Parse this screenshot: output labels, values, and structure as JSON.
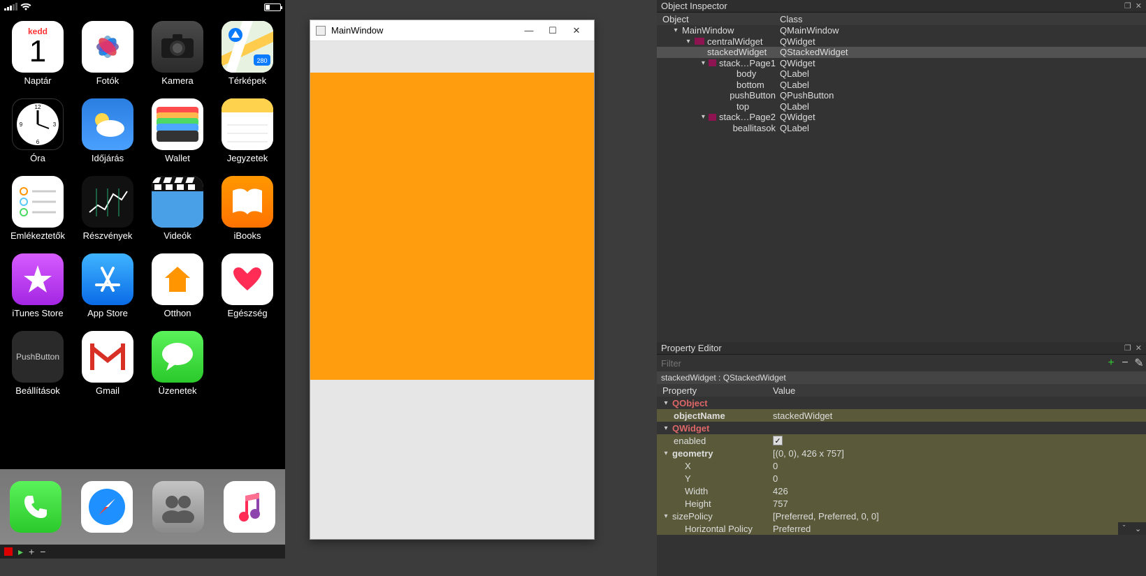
{
  "phone": {
    "calendar": {
      "dow": "kedd",
      "day": "1"
    },
    "apps": {
      "row1": [
        "Naptár",
        "Fotók",
        "Kamera",
        "Térképek"
      ],
      "row2": [
        "Óra",
        "Időjárás",
        "Wallet",
        "Jegyzetek"
      ],
      "row3": [
        "Emlékeztetők",
        "Részvények",
        "Videók",
        "iBooks"
      ],
      "row4": [
        "iTunes Store",
        "App Store",
        "Otthon",
        "Egészség"
      ],
      "row5": [
        "Beállítások",
        "Gmail",
        "Üzenetek"
      ]
    },
    "settings_button_text": "PushButton"
  },
  "mainwindow": {
    "title": "MainWindow"
  },
  "inspector": {
    "title": "Object Inspector",
    "cols": [
      "Object",
      "Class"
    ],
    "rows": [
      {
        "indent": 1,
        "arrow": "▾",
        "name": "MainWindow",
        "cls": "QMainWindow"
      },
      {
        "indent": 2,
        "arrow": "▾",
        "name": "centralWidget",
        "cls": "QWidget",
        "icon": true
      },
      {
        "indent": 3,
        "arrow": "",
        "name": "stackedWidget",
        "cls": "QStackedWidget",
        "sel": true
      },
      {
        "indent": 4,
        "arrow": "▾",
        "name": "stack…Page1",
        "cls": "QWidget",
        "icon": true
      },
      {
        "indent": 5,
        "arrow": "",
        "name": "body",
        "cls": "QLabel"
      },
      {
        "indent": 5,
        "arrow": "",
        "name": "bottom",
        "cls": "QLabel"
      },
      {
        "indent": 5,
        "arrow": "",
        "name": "pushButton",
        "cls": "QPushButton"
      },
      {
        "indent": 5,
        "arrow": "",
        "name": "top",
        "cls": "QLabel"
      },
      {
        "indent": 4,
        "arrow": "▾",
        "name": "stack…Page2",
        "cls": "QWidget",
        "icon": true
      },
      {
        "indent": 5,
        "arrow": "",
        "name": "beallitasok",
        "cls": "QLabel"
      }
    ]
  },
  "propedit": {
    "title": "Property Editor",
    "filter_placeholder": "Filter",
    "context": "stackedWidget : QStackedWidget",
    "cols": [
      "Property",
      "Value"
    ],
    "rows": [
      {
        "type": "cat",
        "k": "QObject"
      },
      {
        "type": "kv",
        "k": "objectName",
        "v": "stackedWidget",
        "bold": true,
        "khaki": true
      },
      {
        "type": "cat",
        "k": "QWidget"
      },
      {
        "type": "kv",
        "k": "enabled",
        "v": "",
        "chk": true,
        "khaki": true
      },
      {
        "type": "grp",
        "k": "geometry",
        "v": "[(0, 0), 426 x 757]",
        "khaki": true,
        "bold": true
      },
      {
        "type": "sub",
        "k": "X",
        "v": "0",
        "khaki": true
      },
      {
        "type": "sub",
        "k": "Y",
        "v": "0",
        "khaki": true
      },
      {
        "type": "sub",
        "k": "Width",
        "v": "426",
        "khaki": true
      },
      {
        "type": "sub",
        "k": "Height",
        "v": "757",
        "khaki": true
      },
      {
        "type": "grp",
        "k": "sizePolicy",
        "v": "[Preferred, Preferred, 0, 0]",
        "khaki": true
      },
      {
        "type": "sub",
        "k": "Horizontal Policy",
        "v": "Preferred",
        "khaki": true
      }
    ]
  }
}
